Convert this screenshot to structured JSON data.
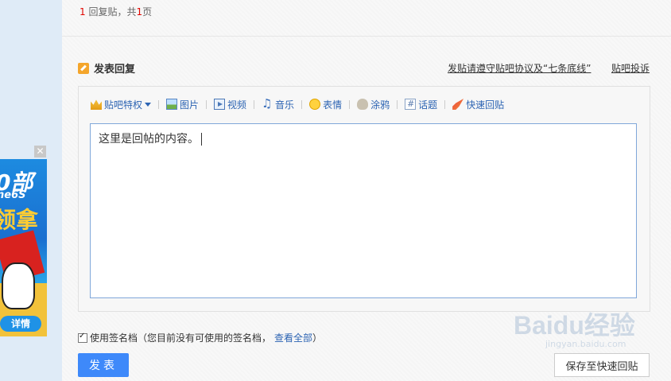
{
  "pager": {
    "count": "1",
    "text_mid": " 回复贴，共",
    "pages": "1",
    "text_end": "页"
  },
  "reply": {
    "title": "发表回复",
    "rules_link": "发贴请遵守贴吧协议及“七条底线”",
    "complaint_link": "贴吧投诉"
  },
  "toolbar": {
    "items": [
      {
        "label": "贴吧特权",
        "icon": "crown-icon"
      },
      {
        "label": "图片",
        "icon": "image-icon"
      },
      {
        "label": "视频",
        "icon": "video-icon"
      },
      {
        "label": "音乐",
        "icon": "music-icon"
      },
      {
        "label": "表情",
        "icon": "emoji-icon"
      },
      {
        "label": "涂鸦",
        "icon": "doodle-icon"
      },
      {
        "label": "话题",
        "icon": "topic-icon"
      },
      {
        "label": "快速回贴",
        "icon": "rocket-icon"
      }
    ]
  },
  "editor": {
    "content": "这里是回帖的内容。"
  },
  "signature": {
    "checked": true,
    "label": "使用签名档（您目前没有可使用的签名档，",
    "view_all": "查看全部",
    "close_paren": "）"
  },
  "buttons": {
    "submit": "发表",
    "save": "保存至快速回贴"
  },
  "ad": {
    "line1": "0部",
    "line2": "ne6S",
    "line3": "领拿",
    "details": "详情",
    "close": "✕"
  },
  "watermark": {
    "main": "Baidu经验",
    "sub": "jingyan.baidu.com"
  },
  "colors": {
    "accent": "#3e89fa",
    "link": "#2d64b3",
    "highlight": "#e10601"
  }
}
